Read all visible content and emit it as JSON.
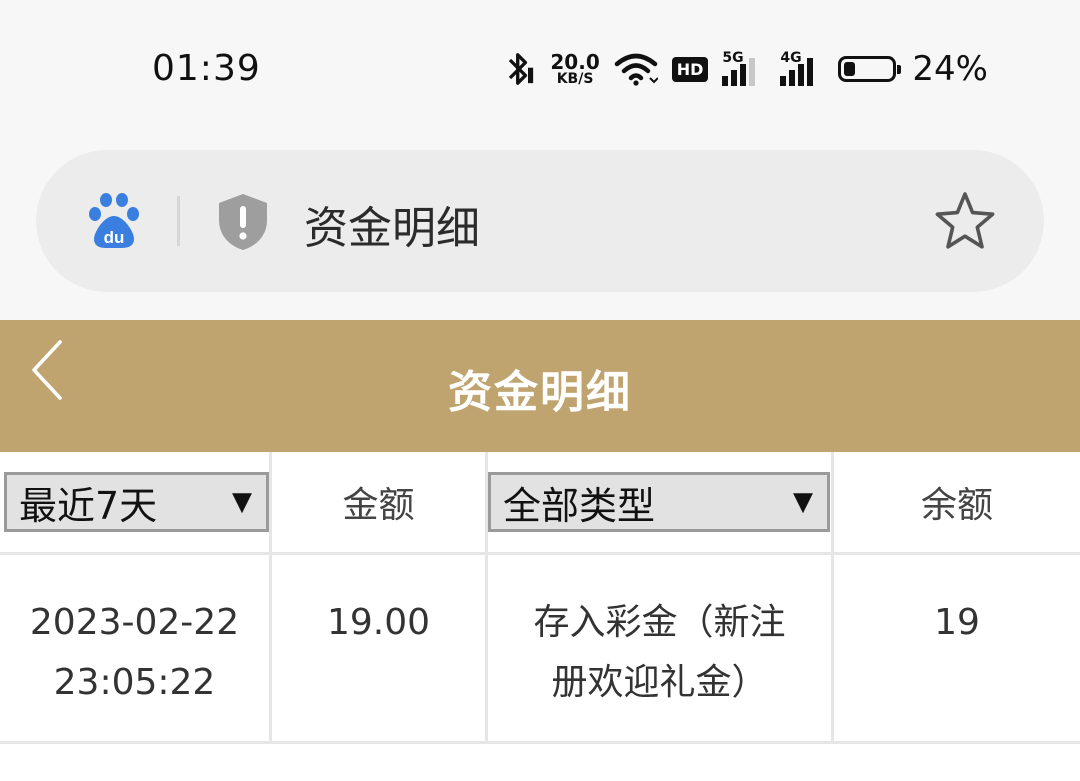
{
  "status_bar": {
    "time": "01:39",
    "net_speed_value": "20.0",
    "net_speed_unit": "KB/S",
    "hd_badge": "HD",
    "signal_1_label": "5G",
    "signal_2_label": "4G",
    "battery_level": 0.24,
    "battery_text": "24%",
    "icons": [
      "bluetooth-icon",
      "wifi-icon",
      "hd-icon",
      "signal-5g-icon",
      "signal-4g-icon",
      "battery-icon"
    ]
  },
  "address_bar": {
    "title": "资金明细",
    "icons": [
      "baidu-icon",
      "security-shield-icon",
      "star-icon"
    ]
  },
  "header": {
    "title": "资金明细",
    "back_icon": "chevron-left-icon",
    "background": "#bfa470"
  },
  "table": {
    "date_filter": "最近7天",
    "amount_header": "金额",
    "type_filter": "全部类型",
    "balance_header": "余额",
    "rows": [
      {
        "date": "2023-02-22",
        "time": "23:05:22",
        "amount": "19.00",
        "type": "存入彩金（新注册欢迎礼金）",
        "type_line1": "存入彩金（新注",
        "type_line2": "册欢迎礼金）",
        "balance": "19"
      }
    ]
  }
}
